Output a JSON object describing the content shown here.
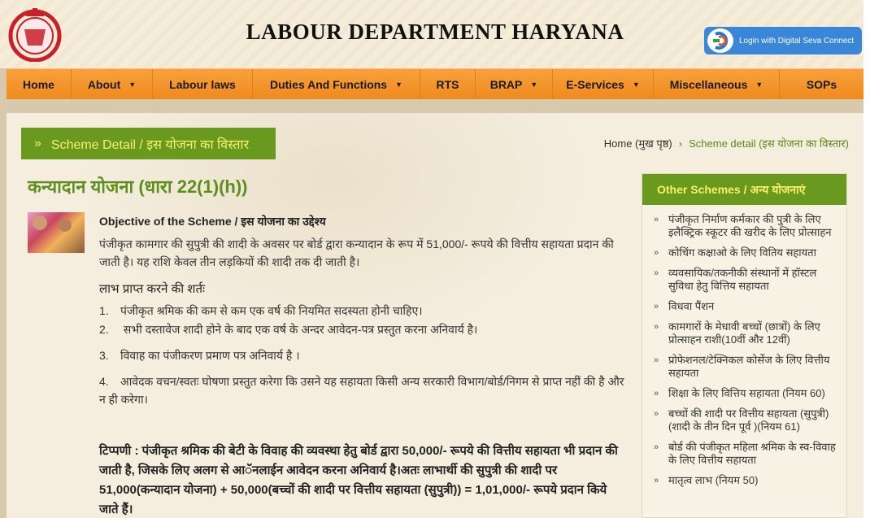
{
  "header": {
    "site_title": "LABOUR DEPARTMENT HARYANA",
    "login_button": "Login with Digital Seva Connect"
  },
  "nav": {
    "items": [
      {
        "label": "Home",
        "dropdown": false
      },
      {
        "label": "About",
        "dropdown": true
      },
      {
        "label": "Labour laws",
        "dropdown": false
      },
      {
        "label": "Duties And Functions",
        "dropdown": true
      },
      {
        "label": "RTS",
        "dropdown": false
      },
      {
        "label": "BRAP",
        "dropdown": true
      },
      {
        "label": "E-Services",
        "dropdown": true
      },
      {
        "label": "Miscellaneous",
        "dropdown": true
      },
      {
        "label": "SOPs",
        "dropdown": false
      }
    ]
  },
  "scheme_header": "Scheme Detail / इस योजना का विस्तार",
  "breadcrumb": {
    "home": "Home (मुख पृष्ठ)",
    "current": "Scheme detail (इस योजना का विस्तार)"
  },
  "page_title": "कन्यादान योजना (धारा 22(1)(h))",
  "objective": {
    "title": "Objective of the Scheme / इस योजना का उद्देश्य",
    "text": " पंजीकृत कामगार की सुपुत्री की शादी के अवसर पर बोर्ड द्वारा कन्यादान के रूप में 51,000/- रूपये की वित्तीय सहायता प्रदान की जाती है। यह राशि केवल तीन लड़कियों की शादी तक दी जाती है।"
  },
  "conditions": {
    "title": "लाभ प्राप्त करने की शर्तः",
    "items": [
      {
        "num": "1.",
        "text": "पंजीकृत श्रमिक की कम से कम एक वर्ष की नियमित सदस्यता होनी चाहिए।"
      },
      {
        "num": "2.",
        "text": " सभी दस्तावेज शादी होने के बाद एक वर्ष के अन्दर आवेदन-पत्र प्रस्तुत करना अनिवार्य है।"
      },
      {
        "num": "3.",
        "text": "विवाह का पंजीकरण प्रमाण पत्र अनिवार्य है ।"
      },
      {
        "num": "4.",
        "text": "आवेदक वचन/स्वतः घोषणा प्रस्तुत करेगा कि उसने यह सहायता  किसी अन्य सरकारी विभाग/बोर्ड/निगम से प्राप्त नहीं की है और न ही करेगा।"
      }
    ]
  },
  "note": "टिप्पणी :  पंजीकृत श्रमिक की बेटी के विवाह की व्यवस्था हेतु बोर्ड द्वारा 50,000/- रूपये की वित्तीय  सहायता भी प्रदान की जाती है, जिसके लिए अलग से आॅनलाईन आवेदन करना अनिवार्य है।अतः लाभार्थी की सुपुत्री की शादी पर 51,000(कन्यादान योजना) + 50,000(बच्चों की शादी पर वित्तीय सहायता (सुपुत्री)) = 1,01,000/- रूपये प्रदान किये जाते हैं।",
  "sidebar": {
    "title": "Other Schemes / अन्य योजनाएं",
    "items": [
      "पंजीकृत निर्माण कर्मकार की पुत्री के लिए इलैक्ट्रिक स्कूटर की खरीद के लिए प्रोत्साहन",
      "कोचिंग कक्षाओ के लिए वितिय सहायता",
      "व्यवसायिक/तकनीकी संस्थानों में हॉस्टल सुविधा हेतु वित्तिय सहायता",
      "विधवा पैंशन",
      "कामगारों के मेधावी बच्चों (छात्रों) के लिए प्रोत्साहन राशी(10वीं और 12वीं)",
      "प्रोफेशनल/टेक्निकल कोर्सेज के लिए वित्तीय सहायता",
      "शिक्षा के लिए वित्तिय सहायता (नियम 60)",
      "बच्चों की शादी पर वित्तीय सहायता (सुपुत्री) (शादी के तीन दिन पूर्व )(नियम 61)",
      "बोर्ड की पंजीकृत महिला श्रमिक के स्व-विवाह के लिए वित्तीय सहायता",
      "मातृत्व लाभ (नियम 50)"
    ]
  },
  "colors": {
    "nav_orange": "#f08a1c",
    "green": "#6a991f",
    "heading_green": "#5c8f1c",
    "yellow_text": "#f7f06a"
  }
}
